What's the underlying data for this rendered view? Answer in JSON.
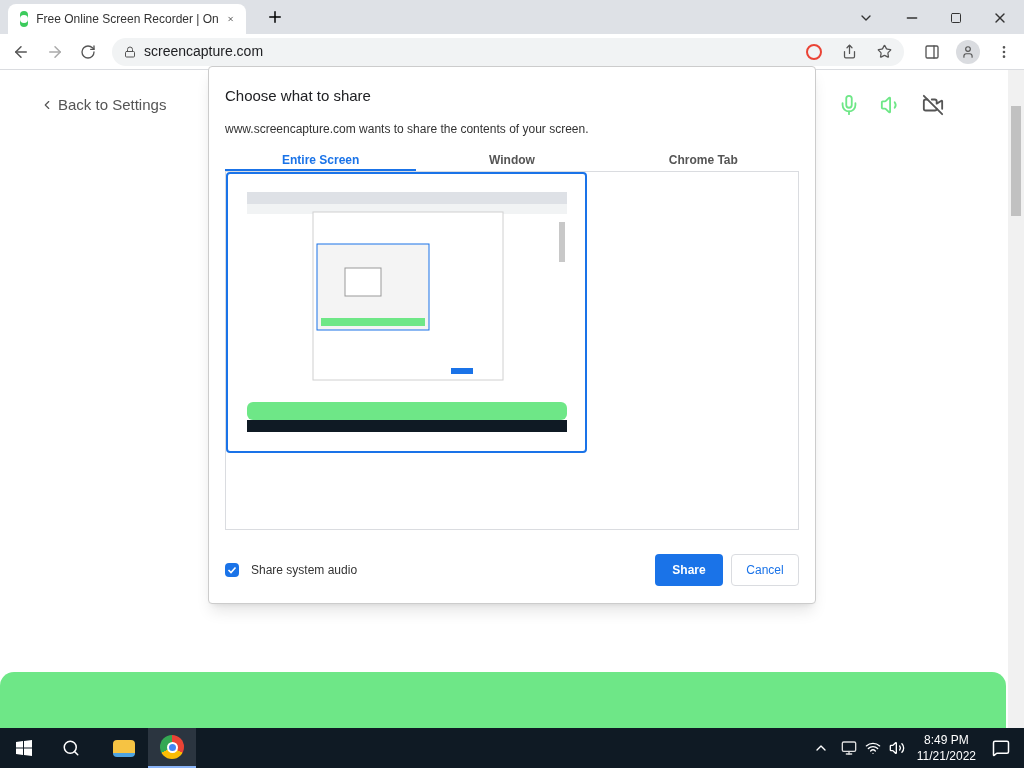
{
  "browser": {
    "tab": {
      "title": "Free Online Screen Recorder | On"
    },
    "url": "screencapture.com"
  },
  "page": {
    "back_link": "Back to Settings",
    "mic_on": true,
    "speaker_on": true,
    "camera_on": false
  },
  "dialog": {
    "title": "Choose what to share",
    "message": "www.screencapture.com wants to share the contents of your screen.",
    "tabs": [
      {
        "label": "Entire Screen",
        "selected": true
      },
      {
        "label": "Window",
        "selected": false
      },
      {
        "label": "Chrome Tab",
        "selected": false
      }
    ],
    "sources": [
      {
        "kind": "picture",
        "selected": true
      }
    ],
    "audio": {
      "label": "Share system audio",
      "checked": true
    },
    "buttons": [
      {
        "label": "Share",
        "kind": "primary"
      },
      {
        "label": "Cancel",
        "kind": "secondary"
      }
    ]
  },
  "taskbar": {
    "apps": [
      {
        "kind": "files",
        "selected": false
      },
      {
        "kind": "chrome",
        "selected": true
      }
    ],
    "time": "8:49 PM",
    "date": "11/21/2022"
  }
}
